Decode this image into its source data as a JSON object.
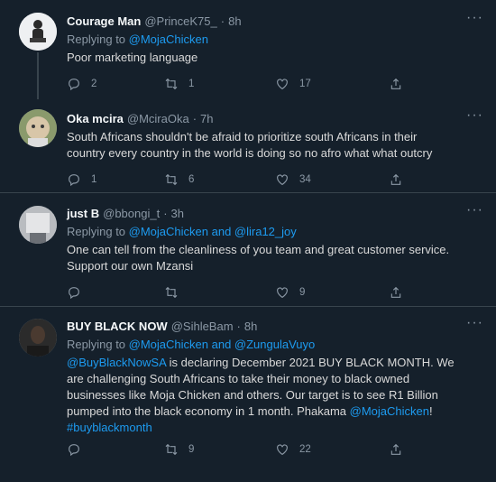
{
  "tweets": [
    {
      "name": "Courage Man",
      "handle": "@PrinceK75_",
      "time": "8h",
      "replying_prefix": "Replying to ",
      "mentions": [
        "@MojaChicken"
      ],
      "text_lines": [
        "Poor marketing language"
      ],
      "reply_count": "2",
      "retweet_count": "1",
      "like_count": "17"
    },
    {
      "name": "Oka mcira",
      "handle": "@MciraOka",
      "time": "7h",
      "text_lines": [
        "South Africans shouldn't be afraid to prioritize south Africans in their",
        "country every country in the world is doing so no afro what what outcry"
      ],
      "reply_count": "1",
      "retweet_count": "6",
      "like_count": "34"
    },
    {
      "name": "just B",
      "handle": "@bbongi_t",
      "time": "3h",
      "replying_prefix": "Replying to ",
      "mentions": [
        "@MojaChicken",
        "@lira12_joy"
      ],
      "replying_joiner": " and ",
      "text_lines": [
        "One can tell from the cleanliness of you team and great customer service.",
        "Support our own Mzansi"
      ],
      "reply_count": "",
      "retweet_count": "",
      "like_count": "9"
    },
    {
      "name": "BUY BLACK NOW",
      "handle": "@SihleBam",
      "time": "8h",
      "replying_prefix": "Replying to ",
      "mentions": [
        "@MojaChicken",
        "@ZungulaVuyo"
      ],
      "replying_joiner": " and ",
      "body": {
        "mention_start": "@BuyBlackNowSA",
        "line1_rest": " is declaring December 2021 BUY BLACK MONTH. We",
        "line2": "are challenging South Africans to take their money to black owned",
        "line3": "businesses like Moja Chicken and others. Our target is to see R1 Billion",
        "line4_start": "pumped into the black economy in 1 month. Phakama ",
        "line4_mention": "@MojaChicken",
        "line4_end": "!",
        "hashtag": "#buyblackmonth"
      },
      "reply_count": "",
      "retweet_count": "9",
      "like_count": "22"
    }
  ],
  "separator": "·",
  "more_glyph": "···",
  "colors": {
    "background": "#15202b",
    "link": "#1d9bf0",
    "muted": "#8b98a5",
    "text": "#d9d9d9",
    "divider": "#38444d"
  }
}
